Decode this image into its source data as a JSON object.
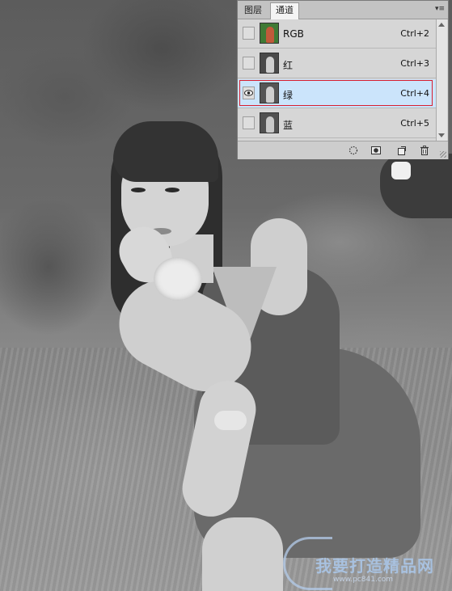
{
  "panel": {
    "tabs": [
      {
        "label": "图层",
        "active": false
      },
      {
        "label": "通道",
        "active": true
      }
    ],
    "menu_icon": "panel-menu-icon",
    "channels": [
      {
        "name": "RGB",
        "shortcut": "Ctrl+2",
        "visible": false,
        "selected": false,
        "thumb": "color"
      },
      {
        "name": "红",
        "shortcut": "Ctrl+3",
        "visible": false,
        "selected": false,
        "thumb": "gray"
      },
      {
        "name": "绿",
        "shortcut": "Ctrl+4",
        "visible": true,
        "selected": true,
        "thumb": "gray"
      },
      {
        "name": "蓝",
        "shortcut": "Ctrl+5",
        "visible": false,
        "selected": false,
        "thumb": "gray"
      }
    ],
    "footer_buttons": [
      {
        "name": "load-channel-as-selection-button",
        "icon": "dotted-circle-icon"
      },
      {
        "name": "save-selection-as-channel-button",
        "icon": "mask-icon"
      },
      {
        "name": "new-channel-button",
        "icon": "new-page-icon"
      },
      {
        "name": "delete-channel-button",
        "icon": "trash-icon"
      }
    ]
  },
  "watermark": {
    "text": "我要打造精品网",
    "url": "www.pc841.com"
  },
  "colors": {
    "selection_highlight": "#cbe4fb",
    "selection_border": "#d81e2e",
    "panel_bg": "#d6d6d6"
  }
}
